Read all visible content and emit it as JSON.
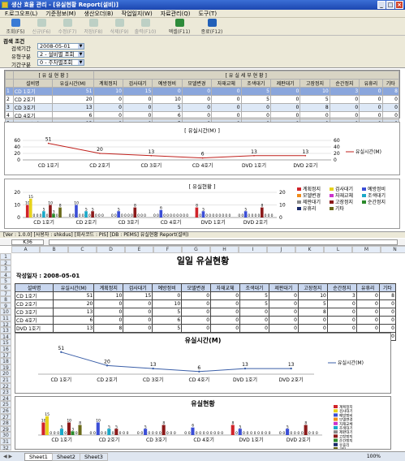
{
  "window": {
    "title": "생산 효율 관리 - [유실현황 Report(설비)]"
  },
  "menu": [
    "F.로그오프(L)",
    "기준정보(M)",
    "생산오더(B)",
    "작업일지(W)",
    "자료관리(Q)",
    "도구(T)"
  ],
  "toolbar": [
    {
      "label": "조회(F5)",
      "enabled": true,
      "color": "#3a7bd5"
    },
    {
      "label": "신규(F6)",
      "enabled": false,
      "color": "#7aa"
    },
    {
      "label": "수정(F7)",
      "enabled": false,
      "color": "#7aa"
    },
    {
      "label": "저장(F8)",
      "enabled": false,
      "color": "#7aa"
    },
    {
      "label": "삭제(F9)",
      "enabled": false,
      "color": "#7aa"
    },
    {
      "label": "출력(F10)",
      "enabled": false,
      "color": "#7aa"
    },
    {
      "label": "엑셀(F11)",
      "enabled": true,
      "color": "#2e8b3a"
    },
    {
      "label": "종료(F12)",
      "enabled": true,
      "color": "#2260b8"
    }
  ],
  "search": {
    "heading": "검색 조건",
    "date_label": "검색기간",
    "date_value": "2008-05-01",
    "type_label": "유형구분",
    "type_value": "2 - 설비별 조회",
    "period_label": "기간구분",
    "period_value": "0 - 주차별조회"
  },
  "grid": {
    "group_left": "[ 유 실 현 황 ]",
    "group_right": "[ 유 실 세 부 현 황 ]",
    "columns": [
      "설비명",
      "유실시간(M)",
      "계획정지",
      "검사대기",
      "예방정비",
      "모델변경",
      "자재교체",
      "조색대기",
      "제판대기",
      "고장정지",
      "순간정지",
      "유휴리",
      "기타"
    ],
    "rows": [
      {
        "no": "1",
        "cells": [
          "CD 1호기",
          "51",
          "10",
          "15",
          "0",
          "0",
          "0",
          "5",
          "0",
          "10",
          "3",
          "0",
          "8"
        ]
      },
      {
        "no": "2",
        "cells": [
          "CD 2호기",
          "20",
          "0",
          "0",
          "10",
          "0",
          "0",
          "5",
          "0",
          "5",
          "0",
          "0",
          "0"
        ]
      },
      {
        "no": "3",
        "cells": [
          "CD 3호기",
          "13",
          "0",
          "0",
          "5",
          "0",
          "0",
          "0",
          "0",
          "8",
          "0",
          "0",
          "0"
        ]
      },
      {
        "no": "4",
        "cells": [
          "CD 4호기",
          "6",
          "0",
          "0",
          "6",
          "0",
          "0",
          "0",
          "0",
          "0",
          "0",
          "0",
          "0"
        ]
      },
      {
        "no": "5",
        "cells": [
          "DVD 1호기",
          "13",
          "8",
          "0",
          "5",
          "0",
          "0",
          "0",
          "0",
          "0",
          "0",
          "0",
          "0"
        ]
      },
      {
        "no": "6",
        "cells": [
          "DVD 2호기",
          "13",
          "0",
          "0",
          "5",
          "0",
          "0",
          "0",
          "0",
          "8",
          "0",
          "0",
          "0"
        ]
      }
    ]
  },
  "line_panel": {
    "title": "[ 유실시간(M) ]",
    "legend": "유실시간(M)",
    "line_color": "#c0201c"
  },
  "bar_panel": {
    "title": "[ 유실현황 ]",
    "legend": [
      {
        "name": "계획정지",
        "color": "#d0242a"
      },
      {
        "name": "검사대기",
        "color": "#e6d21b"
      },
      {
        "name": "예방정비",
        "color": "#3b4ed6"
      },
      {
        "name": "모델변경",
        "color": "#f08c1b"
      },
      {
        "name": "자재교체",
        "color": "#cc33cc"
      },
      {
        "name": "조색대기",
        "color": "#1aa8c8"
      },
      {
        "name": "제판대기",
        "color": "#8a8a8a"
      },
      {
        "name": "고장정지",
        "color": "#8b1a1a"
      },
      {
        "name": "순간정지",
        "color": "#2a8a2a"
      },
      {
        "name": "유휴리",
        "color": "#1a2a6a"
      },
      {
        "name": "기타",
        "color": "#6a6a1a"
      }
    ]
  },
  "statusbar": "[Ver : 1.0.0]   [사용자 : shkdus]   [회사코드 : PIS]   [DB : PEMS]   유실현황 Report(설비)",
  "excel": {
    "namebox": "K36",
    "col_headers": [
      "A",
      "B",
      "C",
      "D",
      "E",
      "F",
      "G",
      "H",
      "I",
      "J",
      "K",
      "L",
      "M",
      "N"
    ],
    "row_headers": [
      "1",
      "2",
      "3",
      "4",
      "5",
      "6",
      "7",
      "8",
      "9",
      "10",
      "11",
      "12",
      "13",
      "14",
      "15",
      "16",
      "17",
      "18",
      "19",
      "20",
      "21",
      "22",
      "23",
      "24",
      "25",
      "26",
      "27",
      "28",
      "29",
      "30",
      "31",
      "32"
    ],
    "title": "일일 유실현황",
    "date_label": "작성일자 : 2008-05-01",
    "line_title": "유실시간(M)",
    "bar_title": "유실현황",
    "sheets": [
      "Sheet1",
      "Sheet2",
      "Sheet3"
    ],
    "zoom": "100%"
  },
  "chart_data": [
    {
      "type": "line",
      "title": "[ 유실시간(M) ]",
      "categories": [
        "CD 1호기",
        "CD 2호기",
        "CD 3호기",
        "CD 4호기",
        "DVD 1호기",
        "DVD 2호기"
      ],
      "series": [
        {
          "name": "유실시간(M)",
          "values": [
            51,
            20,
            13,
            6,
            13,
            13
          ]
        }
      ],
      "ylim": [
        0,
        60
      ],
      "yticks": [
        0,
        20,
        40,
        60
      ],
      "legend": "right"
    },
    {
      "type": "bar",
      "title": "[ 유실현황 ]",
      "categories": [
        "CD 1호기",
        "CD 2호기",
        "CD 3호기",
        "CD 4호기",
        "DVD 1호기",
        "DVD 2호기"
      ],
      "series": [
        {
          "name": "계획정지",
          "values": [
            10,
            0,
            0,
            0,
            8,
            0
          ]
        },
        {
          "name": "검사대기",
          "values": [
            15,
            0,
            0,
            0,
            0,
            0
          ]
        },
        {
          "name": "예방정비",
          "values": [
            0,
            10,
            5,
            6,
            5,
            5
          ]
        },
        {
          "name": "모델변경",
          "values": [
            0,
            0,
            0,
            0,
            0,
            0
          ]
        },
        {
          "name": "자재교체",
          "values": [
            0,
            0,
            0,
            0,
            0,
            0
          ]
        },
        {
          "name": "조색대기",
          "values": [
            5,
            5,
            0,
            0,
            0,
            0
          ]
        },
        {
          "name": "제판대기",
          "values": [
            0,
            0,
            0,
            0,
            0,
            0
          ]
        },
        {
          "name": "고장정지",
          "values": [
            10,
            5,
            8,
            0,
            0,
            8
          ]
        },
        {
          "name": "순간정지",
          "values": [
            3,
            0,
            0,
            0,
            0,
            0
          ]
        },
        {
          "name": "유휴리",
          "values": [
            0,
            0,
            0,
            0,
            0,
            0
          ]
        },
        {
          "name": "기타",
          "values": [
            8,
            0,
            0,
            0,
            0,
            0
          ]
        }
      ],
      "ylim": [
        0,
        20
      ],
      "yticks": [
        0,
        10,
        20
      ],
      "legend": "right"
    },
    {
      "type": "line",
      "title": "유실시간(M)",
      "categories": [
        "CD 1호기",
        "CD 2호기",
        "CD 3호기",
        "CD 4호기",
        "DVD 1호기",
        "DVD 2호기"
      ],
      "series": [
        {
          "name": "유실시간(M)",
          "values": [
            51,
            20,
            13,
            6,
            13,
            13
          ]
        }
      ],
      "ylim": [
        0,
        60
      ],
      "legend": "right"
    },
    {
      "type": "bar",
      "title": "유실현황",
      "categories": [
        "CD 1호기",
        "CD 2호기",
        "CD 3호기",
        "CD 4호기",
        "DVD 1호기",
        "DVD 2호기"
      ],
      "series": [
        {
          "name": "계획정지",
          "values": [
            10,
            0,
            0,
            0,
            8,
            0
          ]
        },
        {
          "name": "검사대기",
          "values": [
            15,
            0,
            0,
            0,
            0,
            0
          ]
        },
        {
          "name": "예방정비",
          "values": [
            0,
            10,
            5,
            6,
            5,
            5
          ]
        },
        {
          "name": "모델변경",
          "values": [
            0,
            0,
            0,
            0,
            0,
            0
          ]
        },
        {
          "name": "자재교체",
          "values": [
            0,
            0,
            0,
            0,
            0,
            0
          ]
        },
        {
          "name": "조색대기",
          "values": [
            5,
            5,
            0,
            0,
            0,
            0
          ]
        },
        {
          "name": "제판대기",
          "values": [
            0,
            0,
            0,
            0,
            0,
            0
          ]
        },
        {
          "name": "고장정지",
          "values": [
            10,
            5,
            8,
            0,
            0,
            8
          ]
        },
        {
          "name": "순간정지",
          "values": [
            3,
            0,
            0,
            0,
            0,
            0
          ]
        },
        {
          "name": "유휴리",
          "values": [
            0,
            0,
            0,
            0,
            0,
            0
          ]
        },
        {
          "name": "기타",
          "values": [
            8,
            0,
            0,
            0,
            0,
            0
          ]
        }
      ],
      "legend": "right"
    }
  ]
}
